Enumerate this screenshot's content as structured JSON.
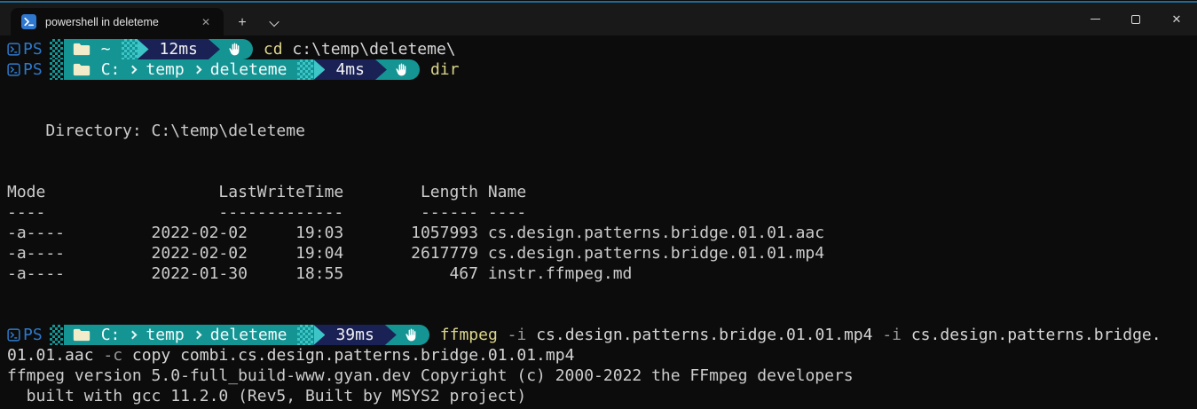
{
  "window": {
    "tab": {
      "title": "powershell in deleteme",
      "close_icon": "✕"
    },
    "new_tab_label": "+",
    "controls": {
      "close_icon": "✕"
    }
  },
  "terminal": {
    "prompts": [
      {
        "shell": "PS",
        "duration": "12ms",
        "cwd": [
          "~"
        ],
        "command": "cd",
        "args": " c:\\temp\\deleteme\\"
      },
      {
        "shell": "PS",
        "duration": "4ms",
        "cwd": [
          "C:",
          "temp",
          "deleteme"
        ],
        "command": "dir"
      },
      {
        "shell": "PS",
        "duration": "39ms",
        "cwd": [
          "C:",
          "temp",
          "deleteme"
        ],
        "command": "ffmpeg",
        "arg_flag1": " -i ",
        "arg_file1": "cs.design.patterns.bridge.01.01.mp4",
        "arg_flag2": " -i ",
        "arg_file2": "cs.design.patterns.bridge."
      }
    ],
    "wrapped_command": {
      "part1": "01.01.aac",
      "flag": " -c ",
      "part2": "copy combi.cs.design.patterns.bridge.01.01.mp4"
    },
    "dir_listing": {
      "label": "Directory:",
      "path": "C:\\temp\\deleteme",
      "columns": {
        "mode": "Mode",
        "lastwritetime": "LastWriteTime",
        "length": "Length",
        "name": "Name"
      },
      "dividers": {
        "mode": "----",
        "lastwritetime": "-------------",
        "length": "------",
        "name": "----"
      },
      "rows": [
        {
          "mode": "-a----",
          "date": "2022-02-02",
          "time": "19:03",
          "length": "1057993",
          "name": "cs.design.patterns.bridge.01.01.aac"
        },
        {
          "mode": "-a----",
          "date": "2022-02-02",
          "time": "19:04",
          "length": "2617779",
          "name": "cs.design.patterns.bridge.01.01.mp4"
        },
        {
          "mode": "-a----",
          "date": "2022-01-30",
          "time": "18:55",
          "length": "467",
          "name": "instr.ffmpeg.md"
        }
      ]
    },
    "output_lines": [
      "ffmpeg version 5.0-full_build-www.gyan.dev Copyright (c) 2000-2022 the FFmpeg developers",
      "  built with gcc 11.2.0 (Rev5, Built by MSYS2 project)"
    ],
    "colors": {
      "teal": "#159494",
      "cyan": "#3cc5c7",
      "navy": "#1a2155",
      "ps_blue": "#2e79c9",
      "command_yellow": "#dbd58a",
      "background": "#0c0c0c"
    }
  }
}
